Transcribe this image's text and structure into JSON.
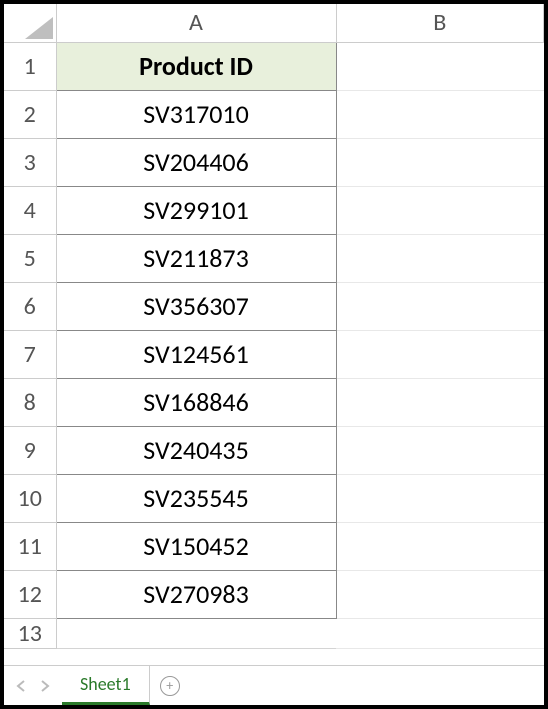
{
  "columns": {
    "A": "A",
    "B": "B"
  },
  "rows": [
    "1",
    "2",
    "3",
    "4",
    "5",
    "6",
    "7",
    "8",
    "9",
    "10",
    "11",
    "12",
    "13"
  ],
  "header_label": "Product ID",
  "data": [
    "SV317010",
    "SV204406",
    "SV299101",
    "SV211873",
    "SV356307",
    "SV124561",
    "SV168846",
    "SV240435",
    "SV235545",
    "SV150452",
    "SV270983"
  ],
  "sheet_tab": "Sheet1"
}
